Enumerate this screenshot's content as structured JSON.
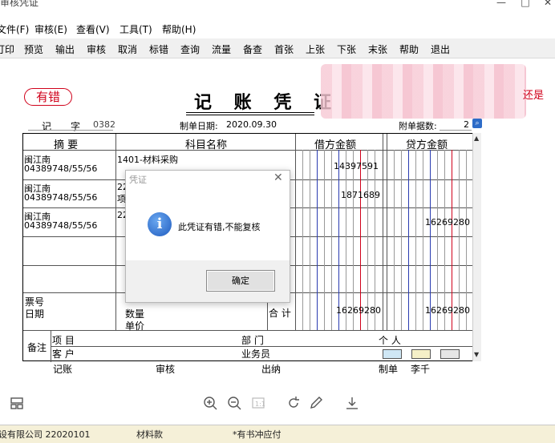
{
  "window": {
    "title": "审核凭证"
  },
  "menu": {
    "items": [
      "文件(F)",
      "审核(E)",
      "查看(V)",
      "工具(T)",
      "帮助(H)"
    ]
  },
  "toolbar": {
    "items": [
      "打印",
      "预览",
      "输出",
      "审核",
      "取消",
      "标错",
      "查询",
      "流量",
      "备查",
      "首张",
      "上张",
      "下张",
      "末张",
      "帮助",
      "退出"
    ]
  },
  "voucher": {
    "error_badge": "有错",
    "title": "记 账 凭 证",
    "red_tail": "还是",
    "type_label": "记",
    "type_suffix": "字",
    "number": "0382",
    "date_label": "制单日期:",
    "date": "2020.09.30",
    "attach_label": "附单据数:",
    "attach_count": "2",
    "headers": {
      "summary": "摘 要",
      "account": "科目名称",
      "debit": "借方金额",
      "credit": "贷方金额"
    },
    "rows": [
      {
        "summary_line1": "闽江南",
        "summary_line2": "04389748/55/56",
        "account": "1401-材料采购",
        "debit": "14397591",
        "credit": ""
      },
      {
        "summary_line1": "闽江南",
        "summary_line2": "04389748/55/56",
        "account_prefix": "22",
        "account_suffix": "项",
        "debit": "1871689",
        "credit": ""
      },
      {
        "summary_line1": "闽江南",
        "summary_line2": "04389748/55/56",
        "account_prefix": "22",
        "debit": "",
        "credit": "16269280"
      }
    ],
    "footer": {
      "ticket_no": "票号",
      "date_label": "日期",
      "quantity": "数量",
      "unit_price": "单价",
      "total_label": "合 计",
      "total_debit": "16269280",
      "total_credit": "16269280"
    },
    "remarks": {
      "label": "备注",
      "project": "项  目",
      "customer": "客  户",
      "department": "部  门",
      "salesperson": "业务员",
      "individual": "个  人"
    },
    "signatures": {
      "bookkeeping": "记账",
      "audit": "审核",
      "cashier": "出纳",
      "preparer_label": "制单",
      "preparer": "李千"
    }
  },
  "dialog": {
    "title": "凭证",
    "message": "此凭证有错,不能复核",
    "ok_button": "确定"
  },
  "statusrow": {
    "col1": "设有限公司 22020101",
    "col2": "材料款",
    "col3": "*有书冲应付"
  },
  "colors": {
    "error_red": "#d0021b",
    "grid_blue": "#2a3bb0",
    "info_blue": "#1f5bbf"
  }
}
